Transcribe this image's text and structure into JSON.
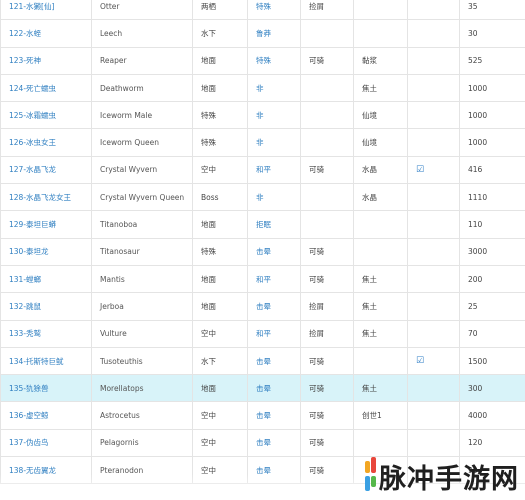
{
  "rows": [
    {
      "name": "121-水獭[仙]",
      "en": "Otter",
      "env": "两栖",
      "temper": "特殊",
      "ride": "",
      "role": "捡屑",
      "res": "",
      "check": "",
      "num": "35"
    },
    {
      "name": "122-水蛭",
      "en": "Leech",
      "env": "水下",
      "temper": "鲁莽",
      "ride": "",
      "role": "",
      "res": "",
      "check": "",
      "num": "30"
    },
    {
      "name": "123-死神",
      "en": "Reaper",
      "env": "地面",
      "temper": "特殊",
      "ride": "可骑",
      "role": "",
      "res": "黏浆",
      "check": "",
      "num": "525"
    },
    {
      "name": "124-死亡蠕虫",
      "en": "Deathworm",
      "env": "地面",
      "temper": "非",
      "ride": "",
      "role": "",
      "res": "焦土",
      "check": "",
      "num": "1000"
    },
    {
      "name": "125-冰霜蠕虫",
      "en": "Iceworm Male",
      "env": "特殊",
      "temper": "非",
      "ride": "",
      "role": "",
      "res": "仙境",
      "check": "",
      "num": "1000"
    },
    {
      "name": "126-冰虫女王",
      "en": "Iceworm Queen",
      "env": "特殊",
      "temper": "非",
      "ride": "",
      "role": "",
      "res": "仙境",
      "check": "",
      "num": "1000"
    },
    {
      "name": "127-水晶飞龙",
      "en": "Crystal Wyvern",
      "env": "空中",
      "temper": "和平",
      "ride": "可骑",
      "role": "",
      "res": "水晶",
      "check": "☑",
      "num": "416"
    },
    {
      "name": "128-水晶飞龙女王",
      "en": "Crystal Wyvern Queen",
      "env": "Boss",
      "temper": "非",
      "ride": "",
      "role": "",
      "res": "水晶",
      "check": "",
      "num": "1110"
    },
    {
      "name": "129-泰坦巨蟒",
      "en": "Titanoboa",
      "env": "地面",
      "temper": "拒眠",
      "ride": "",
      "role": "",
      "res": "",
      "check": "",
      "num": "110"
    },
    {
      "name": "130-泰坦龙",
      "en": "Titanosaur",
      "env": "特殊",
      "temper": "击晕",
      "ride": "可骑",
      "role": "",
      "res": "",
      "check": "",
      "num": "3000"
    },
    {
      "name": "131-螳螂",
      "en": "Mantis",
      "env": "地面",
      "temper": "和平",
      "ride": "可骑",
      "role": "",
      "res": "焦土",
      "check": "",
      "num": "200"
    },
    {
      "name": "132-跳鼠",
      "en": "Jerboa",
      "env": "地面",
      "temper": "击晕",
      "ride": "",
      "role": "捡屑",
      "res": "焦土",
      "check": "",
      "num": "25"
    },
    {
      "name": "133-秃鹫",
      "en": "Vulture",
      "env": "空中",
      "temper": "和平",
      "ride": "",
      "role": "捡屑",
      "res": "焦土",
      "check": "",
      "num": "70"
    },
    {
      "name": "134-托斯特巨鱿",
      "en": "Tusoteuthis",
      "env": "水下",
      "temper": "击晕",
      "ride": "可骑",
      "role": "",
      "res": "",
      "check": "☑",
      "num": "1500"
    },
    {
      "name": "135-犰狳兽",
      "en": "Morellatops",
      "env": "地面",
      "temper": "击晕",
      "ride": "可骑",
      "role": "",
      "res": "焦土",
      "check": "",
      "num": "300"
    },
    {
      "name": "136-虚空鲸",
      "en": "Astrocetus",
      "env": "空中",
      "temper": "击晕",
      "ride": "可骑",
      "role": "",
      "res": "创世1",
      "check": "",
      "num": "4000"
    },
    {
      "name": "137-伪齿鸟",
      "en": "Pelagornis",
      "env": "空中",
      "temper": "击晕",
      "ride": "可骑",
      "role": "",
      "res": "",
      "check": "",
      "num": "120"
    },
    {
      "name": "138-无齿翼龙",
      "en": "Pteranodon",
      "env": "空中",
      "temper": "击晕",
      "ride": "可骑",
      "role": "",
      "res": "",
      "check": "",
      "num": "90"
    }
  ],
  "highlight_row_index": 14,
  "watermark": "脉冲手游网",
  "colors": {
    "link": "#2f7fc1",
    "highlight": "#d8f3f9",
    "border": "#e4e4e4"
  }
}
